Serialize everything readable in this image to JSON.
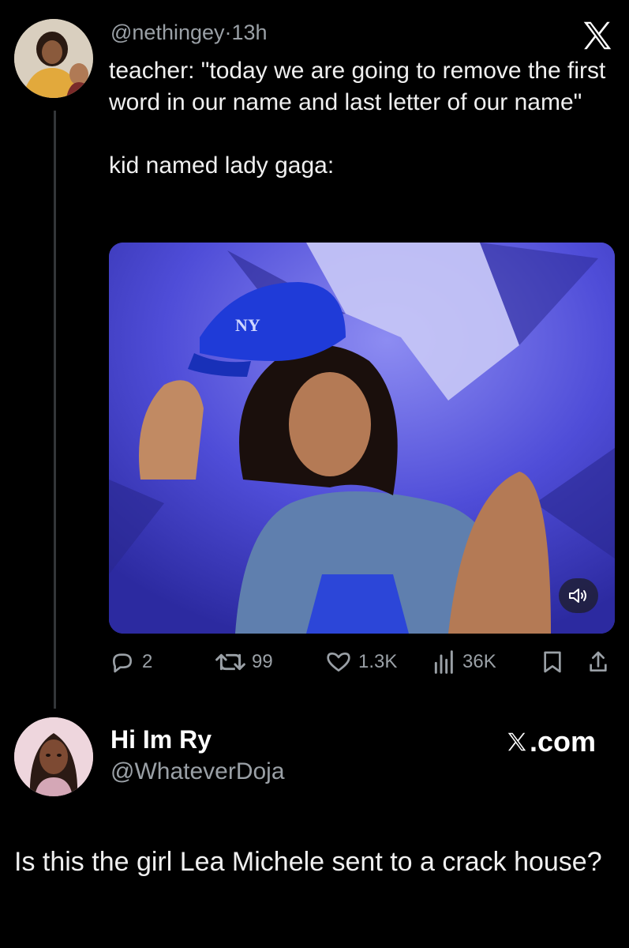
{
  "tweet": {
    "handle": "@nethingey",
    "separator": "·",
    "time": "13h",
    "text": "teacher: \"today we are going to remove the first word in our name and last letter of our name\"\n\nkid named lady gaga:",
    "actions": {
      "replies": "2",
      "retweets": "99",
      "likes": "1.3K",
      "views": "36K"
    }
  },
  "quote_card": {
    "name": "Hi Im Ry",
    "handle": "@WhateverDoja",
    "site": ".com",
    "text": "Is this the girl Lea Michele sent to a crack house?"
  },
  "colors": {
    "background": "#000000",
    "muted_text": "#9aa0a6",
    "thread_line": "#333639",
    "media_blue": "#4a48d6"
  },
  "icons": [
    "x-logo-icon",
    "mute-icon",
    "reply-icon",
    "retweet-icon",
    "like-icon",
    "views-icon",
    "bookmark-icon",
    "share-icon"
  ]
}
